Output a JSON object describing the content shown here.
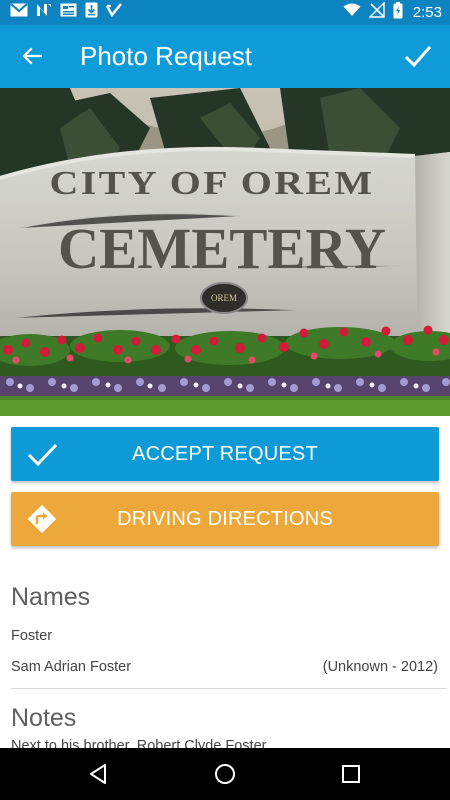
{
  "status_bar": {
    "time": "2:53",
    "icons": [
      "gmail-icon",
      "n-icon",
      "news-icon",
      "download-icon",
      "check-box-icon",
      "wifi-icon",
      "no-signal-icon",
      "battery-charging-icon"
    ]
  },
  "app_bar": {
    "title": "Photo Request",
    "back_icon": "arrow-left-icon",
    "confirm_icon": "check-icon"
  },
  "hero": {
    "sign_line1": "CITY OF OREM",
    "sign_line2": "CEMETERY",
    "seal_text": "OREM"
  },
  "actions": {
    "accept_label": "ACCEPT REQUEST",
    "directions_label": "DRIVING DIRECTIONS",
    "accept_color": "#0e9ad6",
    "directions_color": "#eda83c"
  },
  "names": {
    "title": "Names",
    "surname": "Foster",
    "entries": [
      {
        "name": "Sam Adrian Foster",
        "dates": "(Unknown - 2012)"
      }
    ]
  },
  "notes": {
    "title": "Notes",
    "text": "Next to his brother, Robert Clyde Foster"
  },
  "colors": {
    "primary": "#0f9bd8",
    "status_bar": "#0d83bf",
    "accent": "#eda83c"
  }
}
